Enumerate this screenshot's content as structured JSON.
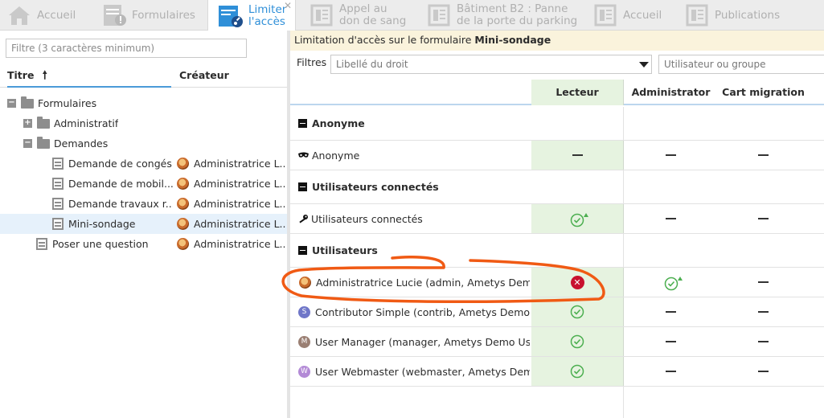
{
  "tabs": [
    {
      "label": "Accueil",
      "icon": "home-icon"
    },
    {
      "label": "Formulaires",
      "icon": "forms-icon"
    },
    {
      "label": "Limiter\nl'accès",
      "icon": "key-form-icon",
      "active": true,
      "close": "✕"
    },
    {
      "label": "Appel au\ndon de sang",
      "icon": "page-icon"
    },
    {
      "label": "Bâtiment B2 : Panne\nde la porte du parking",
      "icon": "page-icon"
    },
    {
      "label": "Accueil",
      "icon": "page-icon"
    },
    {
      "label": "Publications",
      "icon": "page-icon"
    }
  ],
  "left": {
    "filter_placeholder": "Filtre (3 caractères minimum)",
    "col_title": "Titre",
    "col_title_sort": "🠕",
    "col_creator": "Créateur",
    "tree": [
      {
        "label": "Formulaires",
        "type": "folder",
        "expander": "−",
        "creator": ""
      },
      {
        "label": "Administratif",
        "type": "folder",
        "expander": "+",
        "creator": ""
      },
      {
        "label": "Demandes",
        "type": "folder",
        "expander": "−",
        "creator": ""
      },
      {
        "label": "Demande de congés",
        "type": "form",
        "creator": "Administratrice L..."
      },
      {
        "label": "Demande de mobil...",
        "type": "form",
        "creator": "Administratrice L..."
      },
      {
        "label": "Demande travaux r...",
        "type": "form",
        "creator": "Administratrice L..."
      },
      {
        "label": "Mini-sondage",
        "type": "form",
        "creator": "Administratrice L...",
        "selected": true
      },
      {
        "label": "Poser une question",
        "type": "form",
        "creator": "Administratrice L..."
      }
    ]
  },
  "right": {
    "banner_prefix": "Limitation d'accès sur le formulaire ",
    "banner_form": "Mini-sondage",
    "filters_label": "Filtres",
    "right_placeholder": "Libellé du droit",
    "user_placeholder": "Utilisateur ou groupe",
    "columns": [
      "Lecteur",
      "Administrator",
      "Cart migration"
    ],
    "rows": [
      {
        "kind": "group",
        "label": "Anonyme"
      },
      {
        "kind": "entry",
        "label": "Anonyme",
        "icon": "mask-icon",
        "lecteur": "dash",
        "admin": "dash",
        "cart": "dash"
      },
      {
        "kind": "group",
        "label": "Utilisateurs connectés"
      },
      {
        "kind": "entry",
        "label": "Utilisateurs connectés",
        "icon": "key-icon",
        "lecteur": "allowed-inherited",
        "admin": "dash",
        "cart": "dash"
      },
      {
        "kind": "group",
        "label": "Utilisateurs"
      },
      {
        "kind": "entry",
        "label": "Administratrice Lucie (admin, Ametys Demo ...",
        "icon": "avatar-photo",
        "lecteur": "denied",
        "admin": "allowed-inherited",
        "cart": "dash"
      },
      {
        "kind": "entry",
        "label": "Contributor Simple (contrib, Ametys Demo U...",
        "icon": "avatar-letter",
        "letter": "S",
        "letter_color": "#6f76c8",
        "lecteur": "allowed",
        "admin": "dash",
        "cart": "dash"
      },
      {
        "kind": "entry",
        "label": "User Manager (manager, Ametys Demo Users)",
        "icon": "avatar-letter",
        "letter": "M",
        "letter_color": "#9a7f73",
        "lecteur": "allowed",
        "admin": "dash",
        "cart": "dash"
      },
      {
        "kind": "entry",
        "label": "User Webmaster (webmaster, Ametys Demo...",
        "icon": "avatar-letter",
        "letter": "W",
        "letter_color": "#b38ad6",
        "lecteur": "allowed",
        "admin": "dash",
        "cart": "dash"
      }
    ]
  },
  "colors": {
    "accent": "#2f8fd8",
    "allowed": "#4caf50",
    "denied": "#c8102e",
    "lecteur_bg": "#e6f3e0",
    "annotation": "#f05a14"
  }
}
